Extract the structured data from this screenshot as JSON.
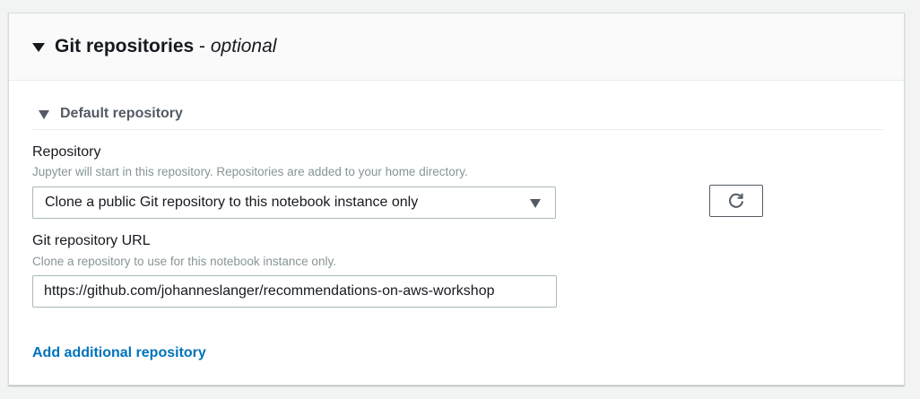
{
  "section": {
    "title": "Git repositories",
    "title_separator": " - ",
    "title_optional": "optional"
  },
  "default_repository": {
    "title": "Default repository"
  },
  "repository_field": {
    "label": "Repository",
    "description": "Jupyter will start in this repository. Repositories are added to your home directory.",
    "selected_value": "Clone a public Git repository to this notebook instance only",
    "refresh_icon": "refresh-icon"
  },
  "git_url_field": {
    "label": "Git repository URL",
    "description": "Clone a repository to use for this notebook instance only.",
    "value": "https://github.com/johanneslanger/recommendations-on-aws-workshop"
  },
  "add_link": {
    "label": "Add additional repository"
  },
  "colors": {
    "link": "#0073bb",
    "text": "#16191f",
    "secondary_text": "#879596",
    "header_bg": "#fafafa",
    "page_bg": "#f2f3f3"
  }
}
